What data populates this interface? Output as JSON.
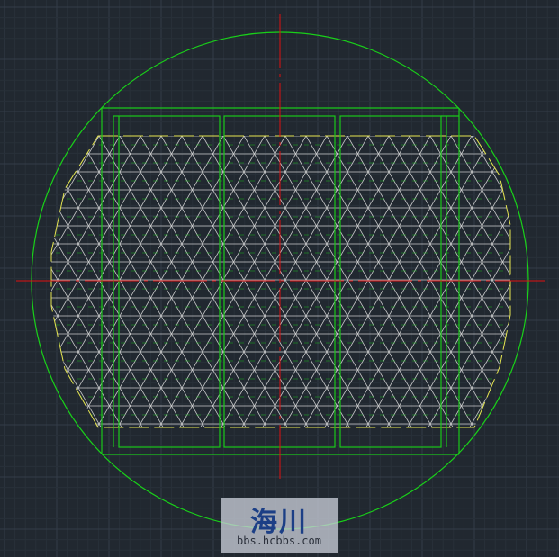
{
  "viewport": {
    "background_color": "#212830",
    "grid_major_color": "#343c48",
    "grid_minor_color": "#283039"
  },
  "drawing": {
    "vessel_outline_color": "#19d119",
    "support_beam_color": "#1ac81a",
    "packing_boundary_color": "#e6e650",
    "packing_mesh_color": "#dcdcdc",
    "centerline_color": "#e01010",
    "centerline_style": "dash-dot"
  },
  "watermark": {
    "logo_text": "海川",
    "url_text": "bbs.hcbbs.com"
  }
}
